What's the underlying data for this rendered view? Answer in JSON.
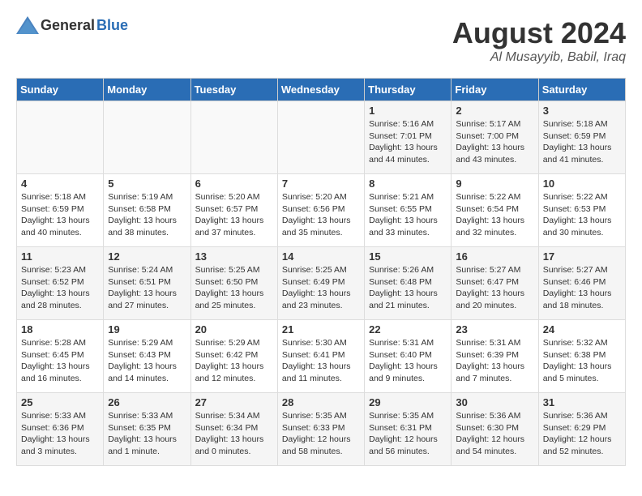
{
  "logo": {
    "general": "General",
    "blue": "Blue"
  },
  "title": "August 2024",
  "location": "Al Musayyib, Babil, Iraq",
  "weekdays": [
    "Sunday",
    "Monday",
    "Tuesday",
    "Wednesday",
    "Thursday",
    "Friday",
    "Saturday"
  ],
  "weeks": [
    [
      {
        "day": "",
        "info": ""
      },
      {
        "day": "",
        "info": ""
      },
      {
        "day": "",
        "info": ""
      },
      {
        "day": "",
        "info": ""
      },
      {
        "day": "1",
        "info": "Sunrise: 5:16 AM\nSunset: 7:01 PM\nDaylight: 13 hours\nand 44 minutes."
      },
      {
        "day": "2",
        "info": "Sunrise: 5:17 AM\nSunset: 7:00 PM\nDaylight: 13 hours\nand 43 minutes."
      },
      {
        "day": "3",
        "info": "Sunrise: 5:18 AM\nSunset: 6:59 PM\nDaylight: 13 hours\nand 41 minutes."
      }
    ],
    [
      {
        "day": "4",
        "info": "Sunrise: 5:18 AM\nSunset: 6:59 PM\nDaylight: 13 hours\nand 40 minutes."
      },
      {
        "day": "5",
        "info": "Sunrise: 5:19 AM\nSunset: 6:58 PM\nDaylight: 13 hours\nand 38 minutes."
      },
      {
        "day": "6",
        "info": "Sunrise: 5:20 AM\nSunset: 6:57 PM\nDaylight: 13 hours\nand 37 minutes."
      },
      {
        "day": "7",
        "info": "Sunrise: 5:20 AM\nSunset: 6:56 PM\nDaylight: 13 hours\nand 35 minutes."
      },
      {
        "day": "8",
        "info": "Sunrise: 5:21 AM\nSunset: 6:55 PM\nDaylight: 13 hours\nand 33 minutes."
      },
      {
        "day": "9",
        "info": "Sunrise: 5:22 AM\nSunset: 6:54 PM\nDaylight: 13 hours\nand 32 minutes."
      },
      {
        "day": "10",
        "info": "Sunrise: 5:22 AM\nSunset: 6:53 PM\nDaylight: 13 hours\nand 30 minutes."
      }
    ],
    [
      {
        "day": "11",
        "info": "Sunrise: 5:23 AM\nSunset: 6:52 PM\nDaylight: 13 hours\nand 28 minutes."
      },
      {
        "day": "12",
        "info": "Sunrise: 5:24 AM\nSunset: 6:51 PM\nDaylight: 13 hours\nand 27 minutes."
      },
      {
        "day": "13",
        "info": "Sunrise: 5:25 AM\nSunset: 6:50 PM\nDaylight: 13 hours\nand 25 minutes."
      },
      {
        "day": "14",
        "info": "Sunrise: 5:25 AM\nSunset: 6:49 PM\nDaylight: 13 hours\nand 23 minutes."
      },
      {
        "day": "15",
        "info": "Sunrise: 5:26 AM\nSunset: 6:48 PM\nDaylight: 13 hours\nand 21 minutes."
      },
      {
        "day": "16",
        "info": "Sunrise: 5:27 AM\nSunset: 6:47 PM\nDaylight: 13 hours\nand 20 minutes."
      },
      {
        "day": "17",
        "info": "Sunrise: 5:27 AM\nSunset: 6:46 PM\nDaylight: 13 hours\nand 18 minutes."
      }
    ],
    [
      {
        "day": "18",
        "info": "Sunrise: 5:28 AM\nSunset: 6:45 PM\nDaylight: 13 hours\nand 16 minutes."
      },
      {
        "day": "19",
        "info": "Sunrise: 5:29 AM\nSunset: 6:43 PM\nDaylight: 13 hours\nand 14 minutes."
      },
      {
        "day": "20",
        "info": "Sunrise: 5:29 AM\nSunset: 6:42 PM\nDaylight: 13 hours\nand 12 minutes."
      },
      {
        "day": "21",
        "info": "Sunrise: 5:30 AM\nSunset: 6:41 PM\nDaylight: 13 hours\nand 11 minutes."
      },
      {
        "day": "22",
        "info": "Sunrise: 5:31 AM\nSunset: 6:40 PM\nDaylight: 13 hours\nand 9 minutes."
      },
      {
        "day": "23",
        "info": "Sunrise: 5:31 AM\nSunset: 6:39 PM\nDaylight: 13 hours\nand 7 minutes."
      },
      {
        "day": "24",
        "info": "Sunrise: 5:32 AM\nSunset: 6:38 PM\nDaylight: 13 hours\nand 5 minutes."
      }
    ],
    [
      {
        "day": "25",
        "info": "Sunrise: 5:33 AM\nSunset: 6:36 PM\nDaylight: 13 hours\nand 3 minutes."
      },
      {
        "day": "26",
        "info": "Sunrise: 5:33 AM\nSunset: 6:35 PM\nDaylight: 13 hours\nand 1 minute."
      },
      {
        "day": "27",
        "info": "Sunrise: 5:34 AM\nSunset: 6:34 PM\nDaylight: 13 hours\nand 0 minutes."
      },
      {
        "day": "28",
        "info": "Sunrise: 5:35 AM\nSunset: 6:33 PM\nDaylight: 12 hours\nand 58 minutes."
      },
      {
        "day": "29",
        "info": "Sunrise: 5:35 AM\nSunset: 6:31 PM\nDaylight: 12 hours\nand 56 minutes."
      },
      {
        "day": "30",
        "info": "Sunrise: 5:36 AM\nSunset: 6:30 PM\nDaylight: 12 hours\nand 54 minutes."
      },
      {
        "day": "31",
        "info": "Sunrise: 5:36 AM\nSunset: 6:29 PM\nDaylight: 12 hours\nand 52 minutes."
      }
    ]
  ]
}
